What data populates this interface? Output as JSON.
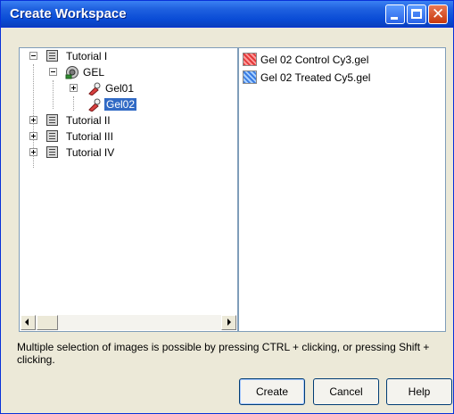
{
  "window": {
    "title": "Create Workspace"
  },
  "tree": {
    "items": [
      {
        "label": "Tutorial I",
        "expanded": true,
        "icon": "book-icon"
      },
      {
        "label": "GEL",
        "expanded": true,
        "icon": "gel-folder-icon"
      },
      {
        "label": "Gel01",
        "expanded": false,
        "icon": "gel-icon"
      },
      {
        "label": "Gel02",
        "selected": true,
        "icon": "gel-icon"
      },
      {
        "label": "Tutorial II",
        "expanded": false,
        "icon": "book-icon"
      },
      {
        "label": "Tutorial III",
        "expanded": false,
        "icon": "book-icon"
      },
      {
        "label": "Tutorial IV",
        "expanded": false,
        "icon": "book-icon"
      }
    ]
  },
  "files": [
    {
      "label": "Gel 02 Control Cy3.gel",
      "icon": "red-gel-image-icon"
    },
    {
      "label": "Gel 02 Treated Cy5.gel",
      "icon": "blue-gel-image-icon"
    }
  ],
  "hint": "Multiple selection of images is possible by pressing CTRL + clicking, or pressing Shift + clicking.",
  "buttons": {
    "create": "Create",
    "cancel": "Cancel",
    "help": "Help"
  },
  "colors": {
    "titlebar": "#0a4cd6",
    "selection": "#316ac5",
    "dialog_bg": "#ece9d8"
  }
}
